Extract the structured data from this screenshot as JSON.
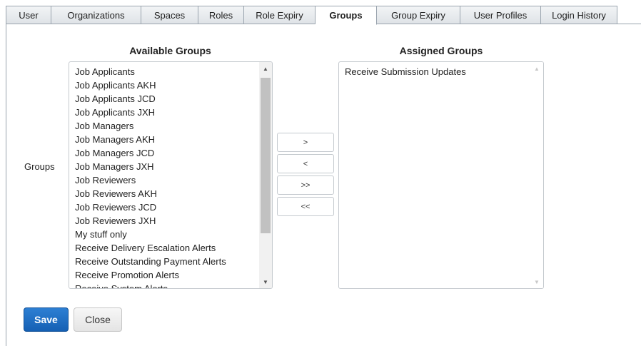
{
  "tabs": [
    {
      "label": "User"
    },
    {
      "label": "Organizations"
    },
    {
      "label": "Spaces"
    },
    {
      "label": "Roles"
    },
    {
      "label": "Role Expiry"
    },
    {
      "label": "Groups",
      "active": true
    },
    {
      "label": "Group Expiry"
    },
    {
      "label": "User Profiles"
    },
    {
      "label": "Login History"
    }
  ],
  "available": {
    "heading": "Available Groups",
    "items": [
      "Job Applicants",
      "Job Applicants AKH",
      "Job Applicants JCD",
      "Job Applicants JXH",
      "Job Managers",
      "Job Managers AKH",
      "Job Managers JCD",
      "Job Managers JXH",
      "Job Reviewers",
      "Job Reviewers AKH",
      "Job Reviewers JCD",
      "Job Reviewers JXH",
      "My stuff only",
      "Receive Delivery Escalation Alerts",
      "Receive Outstanding Payment Alerts",
      "Receive Promotion Alerts",
      "Receive System Alerts"
    ]
  },
  "assigned": {
    "heading": "Assigned Groups",
    "items": [
      "Receive Submission Updates"
    ]
  },
  "row_label": "Groups",
  "move_buttons": {
    "add": ">",
    "remove": "<",
    "add_all": ">>",
    "remove_all": "<<"
  },
  "actions": {
    "save": "Save",
    "close": "Close"
  }
}
